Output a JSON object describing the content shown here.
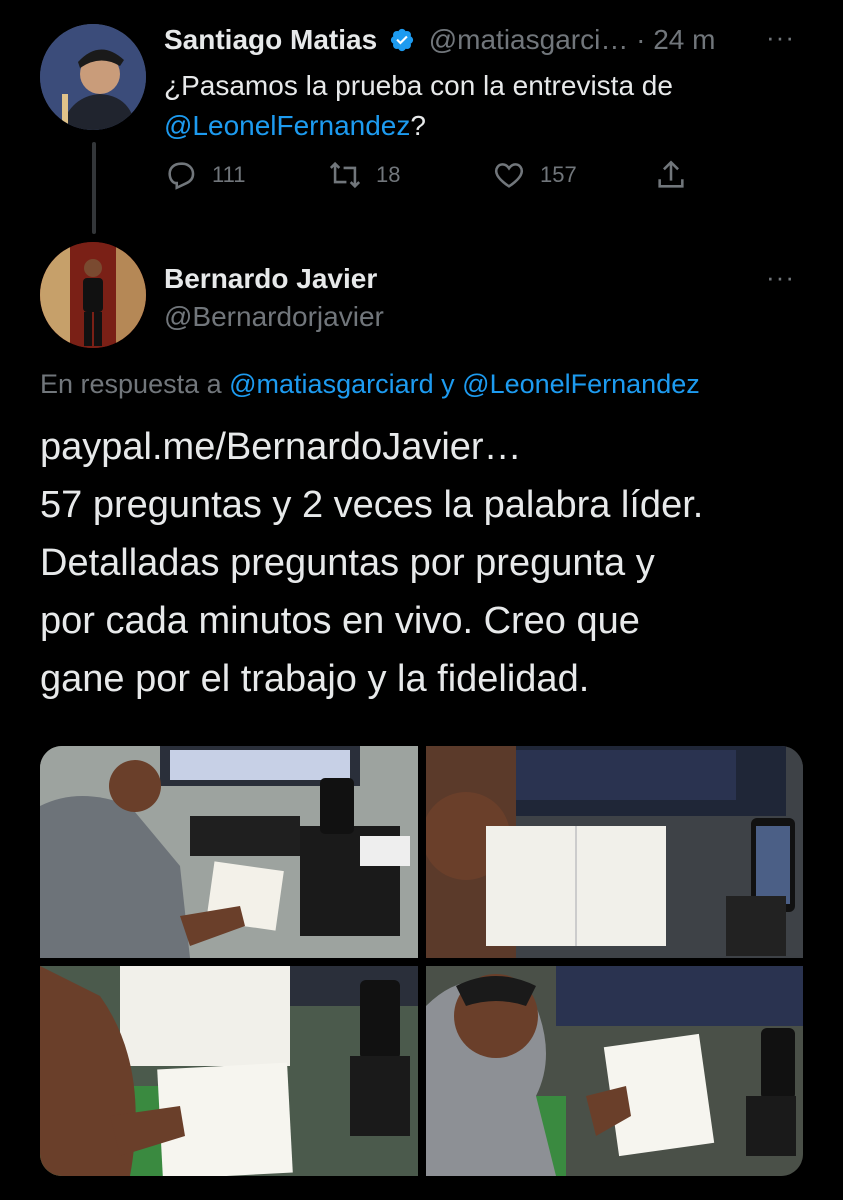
{
  "tweet1": {
    "name": "Santiago Matias",
    "handle": "@matiasgarci…",
    "separator": "·",
    "time": "24 m",
    "text_prefix": "¿Pasamos la prueba con la entrevista de",
    "mention": "@LeonelFernandez",
    "text_suffix": "?",
    "replies": "111",
    "retweets": "18",
    "likes": "157"
  },
  "tweet2": {
    "name": "Bernardo Javier",
    "handle": "@Bernardorjavier",
    "reply_prefix": "En respuesta a",
    "reply_mention1": "@matiasgarciard",
    "reply_and": "y",
    "reply_mention2": "@LeonelFernandez",
    "link": "paypal.me/BernardoJavier…",
    "body_lines": [
      "57 preguntas y 2 veces la palabra líder.",
      "Detalladas preguntas por pregunta y",
      "por cada minutos en vivo. Creo que",
      "gane por el trabajo y la fidelidad."
    ]
  },
  "more_label": "···",
  "colors": {
    "accent": "#1d9bf0",
    "verified": "#1d9bf0",
    "muted": "#71767b",
    "text": "#e7e9ea"
  },
  "icons": [
    "verified-badge-icon",
    "reply-icon",
    "retweet-icon",
    "like-icon",
    "share-icon",
    "more-icon"
  ]
}
